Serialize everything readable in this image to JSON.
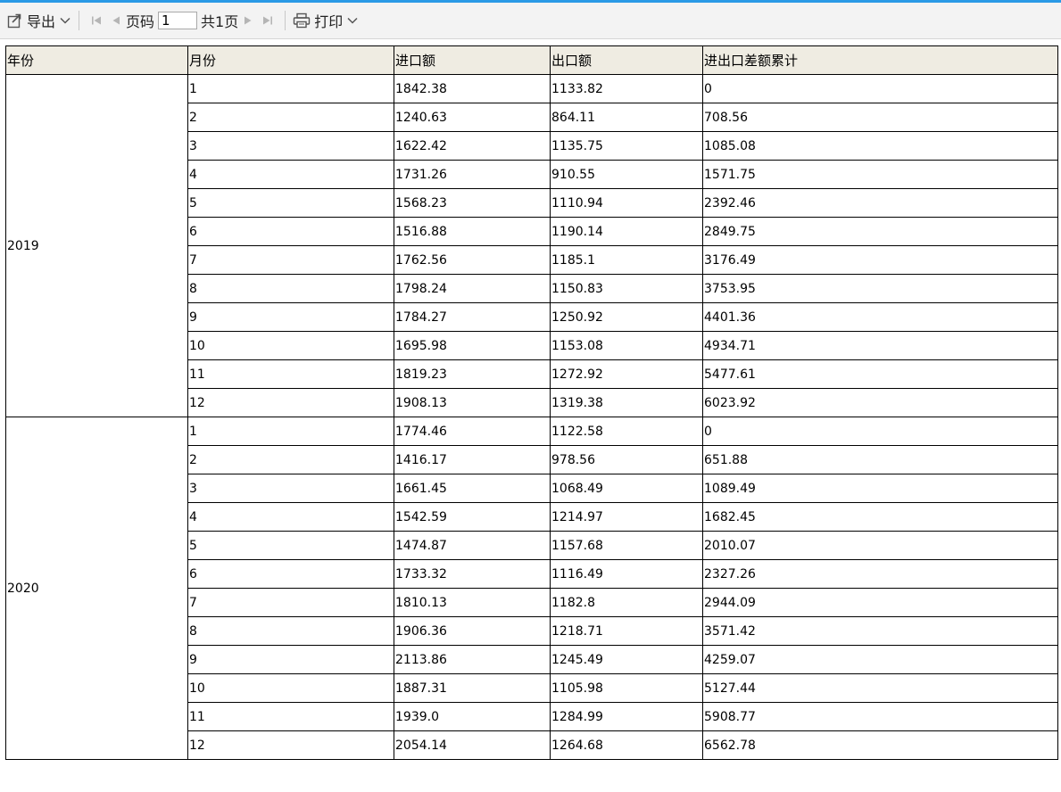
{
  "toolbar": {
    "export_label": "导出",
    "page_label": "页码",
    "page_value": "1",
    "total_label": "共1页",
    "print_label": "打印"
  },
  "table": {
    "headers": [
      "年份",
      "月份",
      "进口额",
      "出口额",
      "进出口差额累计"
    ],
    "groups": [
      {
        "year": "2019",
        "rows": [
          [
            "1",
            "1842.38",
            "1133.82",
            "0"
          ],
          [
            "2",
            "1240.63",
            "864.11",
            "708.56"
          ],
          [
            "3",
            "1622.42",
            "1135.75",
            "1085.08"
          ],
          [
            "4",
            "1731.26",
            "910.55",
            "1571.75"
          ],
          [
            "5",
            "1568.23",
            "1110.94",
            "2392.46"
          ],
          [
            "6",
            "1516.88",
            "1190.14",
            "2849.75"
          ],
          [
            "7",
            "1762.56",
            "1185.1",
            "3176.49"
          ],
          [
            "8",
            "1798.24",
            "1150.83",
            "3753.95"
          ],
          [
            "9",
            "1784.27",
            "1250.92",
            "4401.36"
          ],
          [
            "10",
            "1695.98",
            "1153.08",
            "4934.71"
          ],
          [
            "11",
            "1819.23",
            "1272.92",
            "5477.61"
          ],
          [
            "12",
            "1908.13",
            "1319.38",
            "6023.92"
          ]
        ]
      },
      {
        "year": "2020",
        "rows": [
          [
            "1",
            "1774.46",
            "1122.58",
            "0"
          ],
          [
            "2",
            "1416.17",
            "978.56",
            "651.88"
          ],
          [
            "3",
            "1661.45",
            "1068.49",
            "1089.49"
          ],
          [
            "4",
            "1542.59",
            "1214.97",
            "1682.45"
          ],
          [
            "5",
            "1474.87",
            "1157.68",
            "2010.07"
          ],
          [
            "6",
            "1733.32",
            "1116.49",
            "2327.26"
          ],
          [
            "7",
            "1810.13",
            "1182.8",
            "2944.09"
          ],
          [
            "8",
            "1906.36",
            "1218.71",
            "3571.42"
          ],
          [
            "9",
            "2113.86",
            "1245.49",
            "4259.07"
          ],
          [
            "10",
            "1887.31",
            "1105.98",
            "5127.44"
          ],
          [
            "11",
            "1939.0",
            "1284.99",
            "5908.77"
          ],
          [
            "12",
            "2054.14",
            "1264.68",
            "6562.78"
          ]
        ]
      }
    ]
  }
}
